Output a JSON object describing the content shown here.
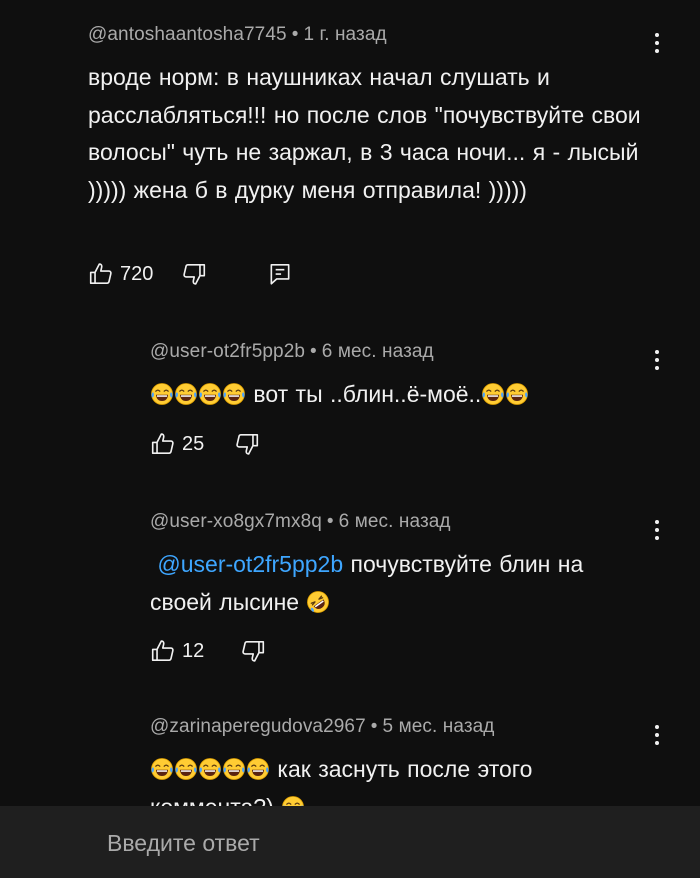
{
  "comments": [
    {
      "author": "@antoshaantosha7745",
      "time": "1 г. назад",
      "text": "вроде норм: в наушниках начал слушать и расслабляться!!!  но после  слов \"почувствуйте свои волосы\"  чуть не заржал, в 3 часа ночи... я - лысый )))))  жена б в дурку меня отправила! )))))",
      "likes": "720"
    },
    {
      "author": "@user-ot2fr5pp2b",
      "time": "6 мес. назад",
      "text": "вот ты ..блин..ё-моё..",
      "likes": "25"
    },
    {
      "author": "@user-xo8gx7mx8q",
      "time": "6 мес. назад",
      "mention": "@user-ot2fr5pp2b",
      "text": "почувствуйте блин на своей лысине",
      "likes": "12"
    },
    {
      "author": "@zarinaperegudova2967",
      "time": "5 мес. назад",
      "text": "как заснуть после этого коммента?)"
    }
  ],
  "separator": "•",
  "reply": {
    "placeholder": "Введите ответ"
  },
  "icons": {
    "like": "thumb-up-icon",
    "dislike": "thumb-down-icon",
    "reply": "reply-icon",
    "more": "more-vert-icon",
    "laugh": "face-with-tears-of-joy-emoji",
    "rofl": "rolling-on-floor-laughing-emoji"
  },
  "colors": {
    "background": "#0f0f0f",
    "text": "#f1f1f1",
    "secondary_text": "#aaaaaa",
    "mention": "#3ea6ff",
    "reply_bar": "#1f1f1f"
  }
}
